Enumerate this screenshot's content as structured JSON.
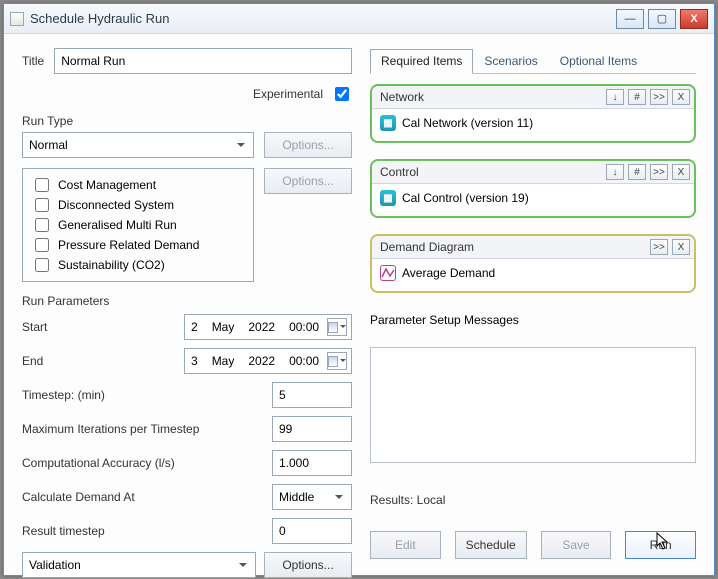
{
  "window": {
    "title": "Schedule Hydraulic Run"
  },
  "titleField": {
    "label": "Title",
    "value": "Normal Run"
  },
  "experimental": {
    "label": "Experimental",
    "checked": true
  },
  "runType": {
    "label": "Run Type",
    "selected": "Normal",
    "optionsBtn1": "Options...",
    "optionsBtn2": "Options...",
    "checks": [
      {
        "label": "Cost Management",
        "checked": false
      },
      {
        "label": "Disconnected System",
        "checked": false
      },
      {
        "label": "Generalised Multi Run",
        "checked": false
      },
      {
        "label": "Pressure Related Demand",
        "checked": false
      },
      {
        "label": "Sustainability (CO2)",
        "checked": false
      }
    ]
  },
  "runParams": {
    "title": "Run Parameters",
    "start": {
      "label": "Start",
      "day": "2",
      "month": "May",
      "year": "2022",
      "time": "00:00"
    },
    "end": {
      "label": "End",
      "day": "3",
      "month": "May",
      "year": "2022",
      "time": "00:00"
    },
    "timestep": {
      "label": "Timestep: (min)",
      "value": "5"
    },
    "maxIter": {
      "label": "Maximum Iterations per Timestep",
      "value": "99"
    },
    "compAcc": {
      "label": "Computational Accuracy (l/s)",
      "value": "1.000"
    },
    "calcDemand": {
      "label": "Calculate Demand At",
      "value": "Middle"
    },
    "resultTs": {
      "label": "Result timestep",
      "value": "0"
    },
    "bottomCombo": "Validation",
    "bottomOptions": "Options..."
  },
  "tabs": {
    "t1": "Required Items",
    "t2": "Scenarios",
    "t3": "Optional Items"
  },
  "cards": {
    "network": {
      "title": "Network",
      "item": "Cal Network (version 11)"
    },
    "control": {
      "title": "Control",
      "item": "Cal Control (version 19)"
    },
    "demand": {
      "title": "Demand Diagram",
      "item": "Average Demand"
    }
  },
  "miniBtns": {
    "down": "↓",
    "hash": "#",
    "fwd": ">>",
    "close": "X"
  },
  "psm": {
    "label": "Parameter Setup Messages"
  },
  "results": {
    "label": "Results: Local",
    "edit": "Edit",
    "schedule": "Schedule",
    "save": "Save",
    "run": "Run"
  }
}
